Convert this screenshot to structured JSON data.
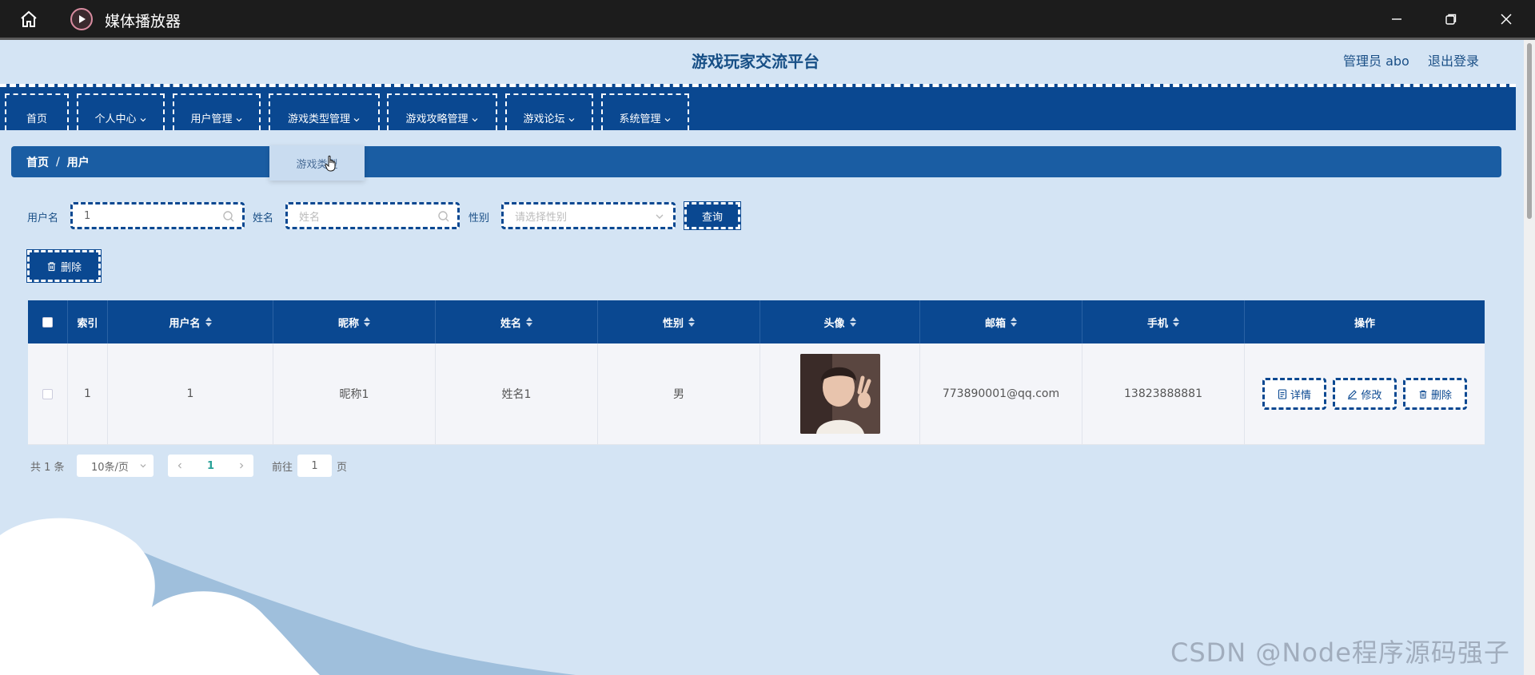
{
  "window": {
    "title": "媒体播放器",
    "minimize": "—",
    "maximize": "❐",
    "close": "✕"
  },
  "header": {
    "site_title": "游戏玩家交流平台",
    "admin_label": "管理员 abo",
    "logout": "退出登录"
  },
  "nav": {
    "items": [
      {
        "label": "首页"
      },
      {
        "label": "个人中心"
      },
      {
        "label": "用户管理"
      },
      {
        "label": "游戏类型管理"
      },
      {
        "label": "游戏攻略管理"
      },
      {
        "label": "游戏论坛"
      },
      {
        "label": "系统管理"
      }
    ],
    "dropdown_item": "游戏类型"
  },
  "breadcrumb": {
    "home": "首页",
    "separator": "/",
    "current": "用户"
  },
  "search": {
    "username_label": "用户名",
    "username_value": "1",
    "name_label": "姓名",
    "name_placeholder": "姓名",
    "gender_label": "性别",
    "gender_placeholder": "请选择性别",
    "query_button": "查询"
  },
  "actions": {
    "delete_button": "删除"
  },
  "table": {
    "columns": [
      "索引",
      "用户名",
      "昵称",
      "姓名",
      "性别",
      "头像",
      "邮箱",
      "手机",
      "操作"
    ],
    "rows": [
      {
        "index": "1",
        "username": "1",
        "nickname": "昵称1",
        "name": "姓名1",
        "gender": "男",
        "email": "773890001@qq.com",
        "phone": "13823888881",
        "ops": [
          "详情",
          "修改",
          "删除"
        ]
      }
    ]
  },
  "pagination": {
    "total": "共 1 条",
    "page_size": "10条/页",
    "current_page": "1",
    "goto_label": "前往",
    "goto_value": "1",
    "page_suffix": "页"
  },
  "watermark": "CSDN @Node程序源码强子",
  "colors": {
    "primary": "#0a4891",
    "breadcrumb": "#1a5da3",
    "background": "#d4e4f4"
  }
}
